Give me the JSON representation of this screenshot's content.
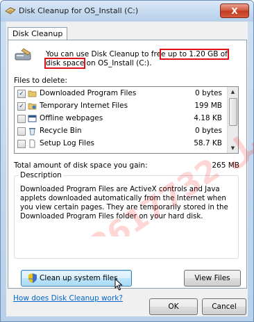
{
  "window": {
    "title": "Disk Cleanup for OS_Install (C:)",
    "close_label": "X"
  },
  "tab": {
    "label": "Disk Cleanup"
  },
  "intro": {
    "before": "You can use Disk Cleanup to fre",
    "highlight": "e up to 1.20 GB of disk space",
    "after": " on OS_Install (C:)."
  },
  "files": {
    "label": "Files to delete:",
    "items": [
      {
        "name": "Downloaded Program Files",
        "size": "0 bytes",
        "checked": true,
        "icon": "folder-icon"
      },
      {
        "name": "Temporary Internet Files",
        "size": "199 MB",
        "checked": true,
        "icon": "folder-icon"
      },
      {
        "name": "Offline webpages",
        "size": "4.18 KB",
        "checked": false,
        "icon": "webpage-icon"
      },
      {
        "name": "Recycle Bin",
        "size": "0 bytes",
        "checked": false,
        "icon": "recycle-bin-icon"
      },
      {
        "name": "Setup Log Files",
        "size": "58.7 KB",
        "checked": false,
        "icon": "document-icon"
      }
    ]
  },
  "total": {
    "label": "Total amount of disk space you gain:",
    "value": "265 MB"
  },
  "description": {
    "title": "Description",
    "text": "Downloaded Program Files are ActiveX controls and Java applets downloaded automatically from the Internet when you view certain pages. They are temporarily stored in the Downloaded Program Files folder on your hard disk."
  },
  "buttons": {
    "cleanup_system": "Clean up system files",
    "view_files": "View Files",
    "ok": "OK",
    "cancel": "Cancel"
  },
  "help_link": "How does Disk Cleanup work?",
  "watermark": {
    "text": "332617732 راجيل"
  },
  "colors": {
    "highlight": "#e0101a",
    "link": "#0066cc"
  }
}
